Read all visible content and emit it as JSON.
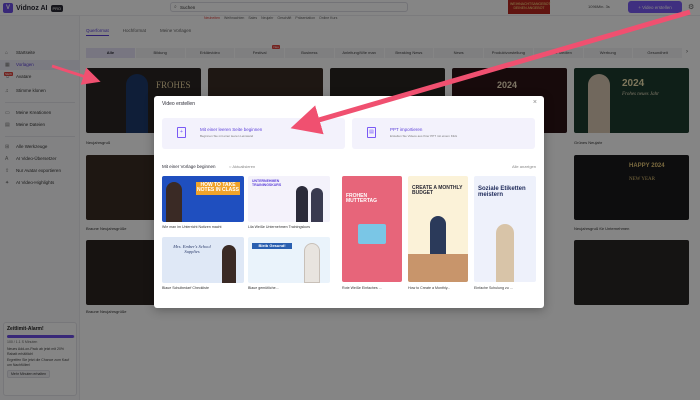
{
  "app": {
    "name": "Vidnoz AI",
    "badge": "PRO"
  },
  "search": {
    "placeholder": "Suchen",
    "value": "Suchen"
  },
  "categories": [
    "Neuheiten",
    "Weihnachten",
    "Sales",
    "Neujahr",
    "Geschäft",
    "Präsentation",
    "Online Kurs"
  ],
  "promo": {
    "line1": "WEIHNACHTSANGEBOT",
    "line2": "DEINEN ANGEBOT"
  },
  "credits": "1096Min. 3s",
  "create_button": "+ Video erstellen",
  "sidebar": {
    "items": [
      "Startseite",
      "Vorlagen",
      "Avatare",
      "Stimme klonen",
      "Meine Kreationen",
      "Meine Dateien",
      "Alle Werkzeuge",
      "AI Video-Übersetzer",
      "Nur Avatar exportieren",
      "AI Video-Highlights"
    ],
    "icons": [
      "home-icon",
      "template-icon",
      "avatar-icon",
      "voice-icon",
      "folder-icon",
      "file-icon",
      "tools-icon",
      "translate-icon",
      "export-icon",
      "highlight-icon"
    ],
    "new_badge": "NEW"
  },
  "alert": {
    "title": "Zeitlimit-Alarm!",
    "progress": 0.98,
    "progress_text": "100 / 1.1 S Minuten",
    "text1": "Neues Add-on-Pack ab jetzt mit 20% Rabatt erhältlich!",
    "text2": "Ergreifen Sie jetzt die Chance zum Kauf um Nachfüllen!",
    "button": "Mehr Minuten erhalten"
  },
  "format_tabs": [
    "Querformat",
    "Hochformat",
    "Meine Vorlagen"
  ],
  "filters": [
    "Alle",
    "Bildung",
    "Erklärvideo",
    "Festival",
    "Business",
    "Anleitung/Wie man",
    "Breaking News",
    "News",
    "Produktvorstellung",
    "Soziale Medien",
    "Werbung",
    "Gesundheit"
  ],
  "filter_new_tag": "Neu",
  "background_captions": [
    "Neujahrsgruß",
    "Grünes Neujahr",
    "Braune Neujahrsgrüße",
    "Neujahrsgruß für Unternehmen",
    "Braune Neujahrsgrüße"
  ],
  "background_texts": [
    "FROHES",
    "2024",
    "2024",
    "Frohes neues Jahr",
    "HAPPY 2024",
    "NEW YEAR"
  ],
  "modal": {
    "title": "Video erstellen",
    "opt1_title": "Mit einer leeren Seite beginnen",
    "opt1_sub": "Beginnen Sie mit einer leeren Leinwand",
    "opt2_title": "PPT importieren",
    "opt2_sub": "Erstellen Sie Videos aus Ihrer PPT mit einem Klick",
    "section_title": "Mit einer Vorlage beginnen",
    "checkbox_label": "Aktualisieren",
    "show_all": "Alle anzeigen",
    "templates": [
      {
        "title": "Wie man im Unterricht Notizen macht",
        "text": "HOW TO TAKE NOTES IN CLASS"
      },
      {
        "title": "Lila Weiße Unternehmen Trainingskurs",
        "text": "UNTERNEHMEN TRAININGSKURS"
      },
      {
        "title": "Rote Weiße Einfaches ...",
        "text": "FROHEN MUTTERTAG"
      },
      {
        "title": "How to Create a Monthly...",
        "text": "CREATE A MONTHLY BUDGET"
      },
      {
        "title": "Einfache Schulung zu ...",
        "text": "Soziale Etiketten meistern"
      },
      {
        "title": "Blaue Schulbedarf Checkliste",
        "text": "Mrs. Ember's School Supplies"
      },
      {
        "title": "Blaue gemütliche...",
        "text": "Bleib Gesund!"
      }
    ]
  }
}
